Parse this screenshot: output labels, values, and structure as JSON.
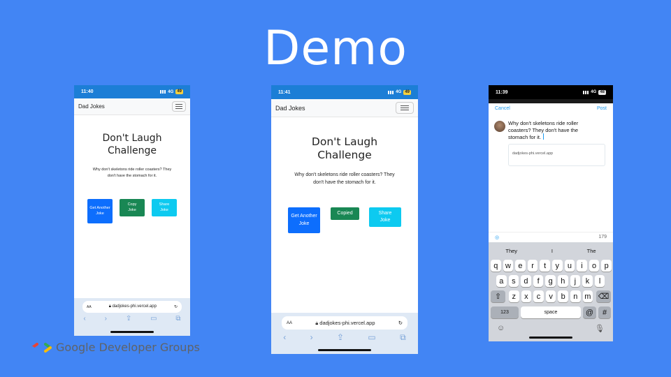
{
  "slide": {
    "title": "Demo",
    "brand": "Google Developer Groups",
    "brand_colors": [
      "#ea4335",
      "#34a853",
      "#4285f4",
      "#fbbc04"
    ]
  },
  "phones": [
    {
      "time": "11:40",
      "network": "4G",
      "battery": "49",
      "nav_brand": "Dad Jokes",
      "heading_line1": "Don't Laugh",
      "heading_line2": "Challenge",
      "joke": "Why don't skeletons ride roller coasters? They don't have the stomach for it.",
      "buttons": {
        "get": "Get Another Joke",
        "copy": "Copy Joke",
        "share": "Share Joke"
      },
      "url_aa": "AA",
      "url": "dadjokes-phi.vercel.app"
    },
    {
      "time": "11:41",
      "network": "4G",
      "battery": "49",
      "nav_brand": "Dad Jokes",
      "heading_line1": "Don't Laugh",
      "heading_line2": "Challenge",
      "joke": "Why don't skeletons ride roller coasters? They don't have the stomach for it.",
      "buttons": {
        "get": "Get Another Joke",
        "copy": "Copied",
        "share": "Share Joke"
      },
      "url_aa": "AA",
      "url": "dadjokes-phi.vercel.app"
    }
  ],
  "compose": {
    "time": "11:39",
    "network": "4G",
    "battery": "48",
    "cancel": "Cancel",
    "post": "Post",
    "text": "Why don't skeletons ride roller coasters? They don't have the stomach for it.",
    "link_card": "dadjokes-phi.vercel.app",
    "char_count": "179",
    "suggestions": [
      "They",
      "I",
      "The"
    ],
    "row1": [
      "q",
      "w",
      "e",
      "r",
      "t",
      "y",
      "u",
      "i",
      "o",
      "p"
    ],
    "row2": [
      "a",
      "s",
      "d",
      "f",
      "g",
      "h",
      "j",
      "k",
      "l"
    ],
    "row3": [
      "z",
      "x",
      "c",
      "v",
      "b",
      "n",
      "m"
    ],
    "key_123": "123",
    "key_space": "space",
    "key_at": "@",
    "key_hash": "#"
  },
  "colors": {
    "background": "#4285f4",
    "primary": "#0d6efd",
    "success": "#198754",
    "info": "#0dcaf0"
  }
}
